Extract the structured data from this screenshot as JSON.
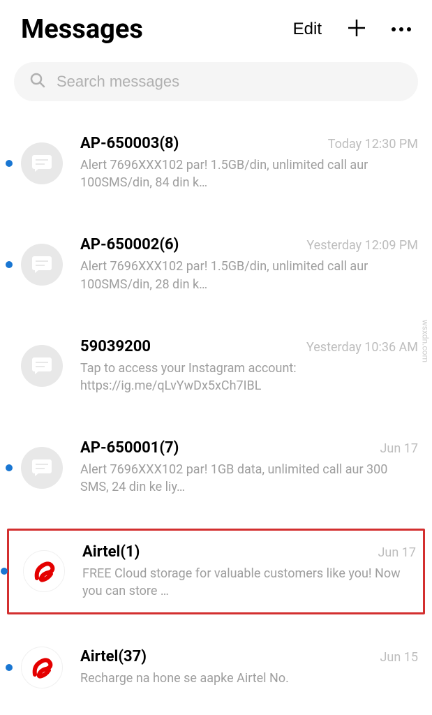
{
  "header": {
    "title": "Messages",
    "edit_label": "Edit"
  },
  "search": {
    "placeholder": "Search messages"
  },
  "conversations": [
    {
      "sender": "AP-650003(8)",
      "timestamp": "Today 12:30 PM",
      "preview": "Alert 7696XXX102 par! 1.5GB/din, unlimited call aur 100SMS/din, 84 din k…",
      "unread": true,
      "icon": "message"
    },
    {
      "sender": "AP-650002(6)",
      "timestamp": "Yesterday 12:09 PM",
      "preview": "Alert 7696XXX102 par! 1.5GB/din, unlimited call aur 100SMS/din, 28 din k…",
      "unread": true,
      "icon": "message"
    },
    {
      "sender": "59039200",
      "timestamp": "Yesterday 10:36 AM",
      "preview": "Tap to access your Instagram account: https://ig.me/qLvYwDx5xCh7IBL",
      "unread": false,
      "icon": "message"
    },
    {
      "sender": "AP-650001(7)",
      "timestamp": "Jun 17",
      "preview": "Alert 7696XXX102 par!  1GB data, unlimited call aur 300 SMS, 24 din ke liy…",
      "unread": true,
      "icon": "message"
    },
    {
      "sender": "Airtel(1)",
      "timestamp": "Jun 17",
      "preview": "FREE Cloud storage for valuable customers like you! Now you can store …",
      "unread": true,
      "icon": "airtel",
      "highlighted": true
    },
    {
      "sender": "Airtel(37)",
      "timestamp": "Jun 15",
      "preview": "Recharge na hone se aapke Airtel No.",
      "unread": true,
      "icon": "airtel"
    }
  ],
  "watermark": "wsxdn.com"
}
